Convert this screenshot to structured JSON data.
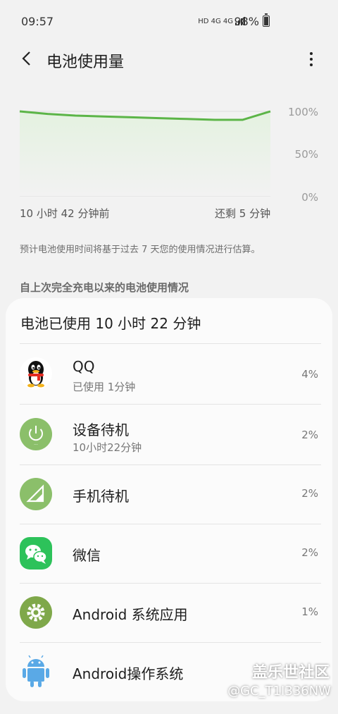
{
  "status_bar": {
    "time": "09:57",
    "network": "HD 4G 4G",
    "battery": "98%"
  },
  "header": {
    "title": "电池使用量"
  },
  "chart": {
    "y_ticks": [
      "100%",
      "50%",
      "0%"
    ],
    "x_start_label": "10 小时 42 分钟前",
    "x_end_label": "还剩 5 分钟",
    "line_color": "#5cb548",
    "fill_color": "#e4f2e0"
  },
  "chart_data": {
    "type": "area",
    "x": [
      "10 小时 42 分钟前",
      "还剩 5 分钟"
    ],
    "values": [
      100,
      97,
      95,
      94,
      93,
      92,
      91,
      90,
      90,
      100
    ],
    "ylim": [
      0,
      100
    ]
  },
  "note": "预计电池使用时间将基于过去 7 天您的使用情况进行估算。",
  "section_title": "自上次完全充电以来的电池使用情况",
  "card": {
    "title": "电池已使用 10 小时 22 分钟",
    "apps": [
      {
        "name": "QQ",
        "sub": "已使用 1分钟",
        "pct": "4%",
        "icon": "qq-penguin-icon"
      },
      {
        "name": "设备待机",
        "sub": "10小时22分钟",
        "pct": "2%",
        "icon": "power-icon"
      },
      {
        "name": "手机待机",
        "sub": "",
        "pct": "2%",
        "icon": "signal-icon"
      },
      {
        "name": "微信",
        "sub": "",
        "pct": "2%",
        "icon": "wechat-icon"
      },
      {
        "name": "Android 系统应用",
        "sub": "",
        "pct": "1%",
        "icon": "settings-gear-icon"
      },
      {
        "name": "Android操作系统",
        "sub": "",
        "pct": "",
        "icon": "android-robot-icon"
      }
    ]
  },
  "watermark": {
    "line1": "盖乐世社区",
    "line2": "@GC_T1I336NW"
  }
}
